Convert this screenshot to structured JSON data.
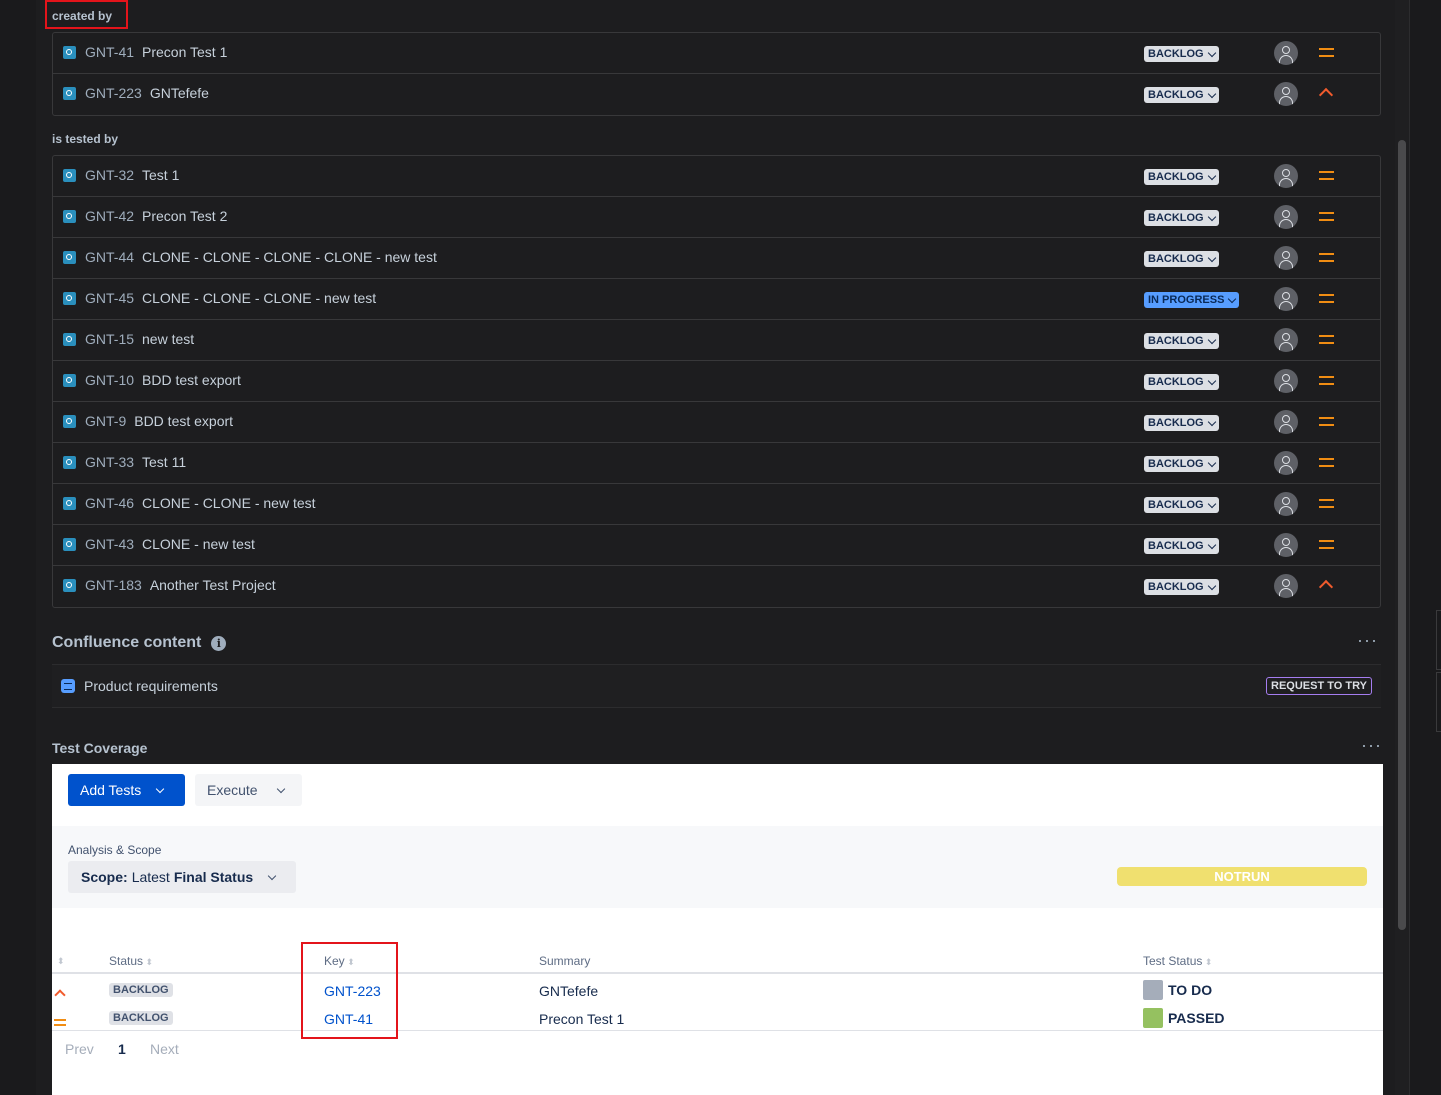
{
  "created_by": {
    "label": "created by",
    "issues": [
      {
        "key": "GNT-41",
        "summary": "Precon Test 1",
        "status": "BACKLOG",
        "priority": "medium"
      },
      {
        "key": "GNT-223",
        "summary": "GNTefefe",
        "status": "BACKLOG",
        "priority": "high"
      }
    ]
  },
  "is_tested_by": {
    "label": "is tested by",
    "issues": [
      {
        "key": "GNT-32",
        "summary": "Test 1",
        "status": "BACKLOG",
        "priority": "medium"
      },
      {
        "key": "GNT-42",
        "summary": "Precon Test 2",
        "status": "BACKLOG",
        "priority": "medium"
      },
      {
        "key": "GNT-44",
        "summary": "CLONE - CLONE - CLONE - CLONE - new test",
        "status": "BACKLOG",
        "priority": "medium"
      },
      {
        "key": "GNT-45",
        "summary": "CLONE - CLONE - CLONE - new test",
        "status": "IN PROGRESS",
        "priority": "medium"
      },
      {
        "key": "GNT-15",
        "summary": "new test",
        "status": "BACKLOG",
        "priority": "medium"
      },
      {
        "key": "GNT-10",
        "summary": "BDD test export",
        "status": "BACKLOG",
        "priority": "medium"
      },
      {
        "key": "GNT-9",
        "summary": "BDD test export",
        "status": "BACKLOG",
        "priority": "medium"
      },
      {
        "key": "GNT-33",
        "summary": "Test 11",
        "status": "BACKLOG",
        "priority": "medium"
      },
      {
        "key": "GNT-46",
        "summary": "CLONE - CLONE - new test",
        "status": "BACKLOG",
        "priority": "medium"
      },
      {
        "key": "GNT-43",
        "summary": "CLONE - new test",
        "status": "BACKLOG",
        "priority": "medium"
      },
      {
        "key": "GNT-183",
        "summary": "Another Test Project",
        "status": "BACKLOG",
        "priority": "high"
      }
    ]
  },
  "confluence": {
    "title": "Confluence content",
    "item": "Product requirements",
    "request_label": "REQUEST TO TRY"
  },
  "test_coverage": {
    "title": "Test Coverage",
    "add_tests_label": "Add Tests",
    "execute_label": "Execute",
    "analysis_label": "Analysis & Scope",
    "scope_prefix": "Scope:",
    "scope_latest": "Latest",
    "scope_final": "Final Status",
    "notrun_label": "NOTRUN",
    "columns": {
      "status": "Status",
      "key": "Key",
      "summary": "Summary",
      "test_status": "Test Status"
    },
    "rows": [
      {
        "priority": "high",
        "status": "BACKLOG",
        "key": "GNT-223",
        "summary": "GNTefefe",
        "test_status": "TO DO",
        "test_status_color": "#a5adba"
      },
      {
        "priority": "medium",
        "status": "BACKLOG",
        "key": "GNT-41",
        "summary": "Precon Test 1",
        "test_status": "PASSED",
        "test_status_color": "#95c160"
      }
    ],
    "pager": {
      "prev": "Prev",
      "page": "1",
      "next": "Next"
    }
  },
  "colors": {
    "background": "#1d1d1f",
    "highlight": "#e3141b",
    "accent": "#0052cc",
    "priority_medium": "#f18d13",
    "priority_high": "#f15b2d"
  }
}
